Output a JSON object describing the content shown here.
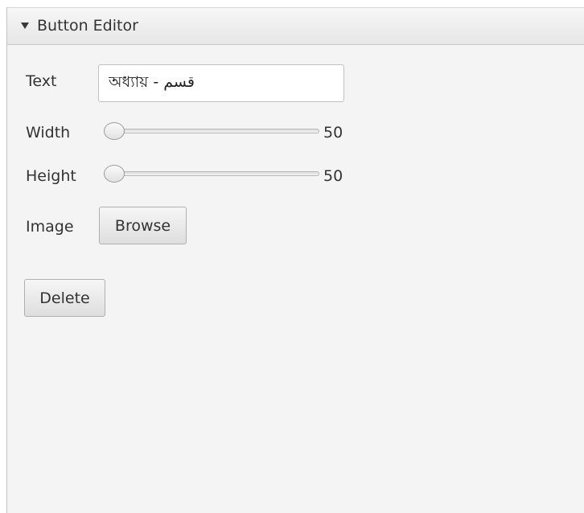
{
  "editor": {
    "title": "Button Editor",
    "text_label": "Text",
    "text_value": "অধ্যায় - قسم",
    "width_label": "Width",
    "width_value": 50,
    "width_value_text": "50",
    "height_label": "Height",
    "height_value": 50,
    "height_value_text": "50",
    "image_label": "Image",
    "browse_label": "Browse",
    "delete_label": "Delete"
  }
}
